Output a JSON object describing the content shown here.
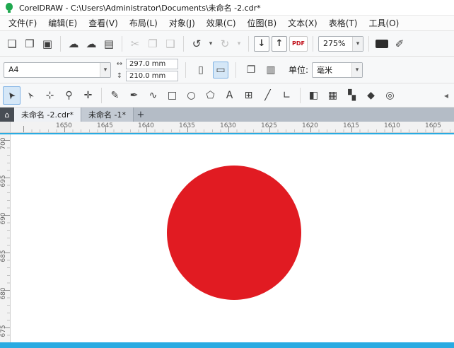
{
  "window": {
    "title": "CorelDRAW - C:\\Users\\Administrator\\Documents\\未命名 -2.cdr*"
  },
  "menu": {
    "items": [
      "文件(F)",
      "编辑(E)",
      "查看(V)",
      "布局(L)",
      "对象(J)",
      "效果(C)",
      "位图(B)",
      "文本(X)",
      "表格(T)",
      "工具(O)"
    ]
  },
  "toolbar": {
    "new_icon": "❏",
    "open_icon": "❒",
    "save_icon": "▣",
    "cloud_open_icon": "☁",
    "cloud_save_icon": "☁",
    "print_icon": "▤",
    "cut_icon": "✂",
    "copy_icon": "❐",
    "paste_icon": "❑",
    "undo_icon": "↺",
    "redo_icon": "↻",
    "caret": "▾",
    "import_icon": "↓",
    "export_icon": "↑",
    "pdf_label": "PDF",
    "zoom_value": "275%",
    "options_icon": "✐"
  },
  "property_bar": {
    "page_size": "A4",
    "caret": "▾",
    "width_icon": "↔",
    "width_value": "297.0 mm",
    "height_icon": "↕",
    "height_value": "210.0 mm",
    "portrait_icon": "▯",
    "landscape_icon": "▭",
    "all_pages_icon": "❐",
    "current_page_icon": "▥",
    "units_label": "单位:",
    "units_value": "毫米"
  },
  "toolbox": {
    "tools": [
      {
        "name": "pick",
        "glyph": "➤"
      },
      {
        "name": "shape",
        "glyph": "➢"
      },
      {
        "name": "crop",
        "glyph": "⊹"
      },
      {
        "name": "zoom",
        "glyph": "⚲"
      },
      {
        "name": "pan",
        "glyph": "✛"
      },
      {
        "name": "freehand",
        "glyph": "✎"
      },
      {
        "name": "pen",
        "glyph": "✒"
      },
      {
        "name": "b-spline",
        "glyph": "∿"
      },
      {
        "name": "rectangle",
        "glyph": "□"
      },
      {
        "name": "ellipse",
        "glyph": "○"
      },
      {
        "name": "polygon",
        "glyph": "⬠"
      },
      {
        "name": "text",
        "glyph": "A"
      },
      {
        "name": "table",
        "glyph": "⊞"
      },
      {
        "name": "dimension",
        "glyph": "╱"
      },
      {
        "name": "connector",
        "glyph": "∟"
      },
      {
        "name": "interactive-fill",
        "glyph": "◧"
      },
      {
        "name": "mesh-fill",
        "glyph": "▦"
      },
      {
        "name": "transparency",
        "glyph": "▚"
      },
      {
        "name": "eyedropper",
        "glyph": "◆"
      },
      {
        "name": "outline-pen",
        "glyph": "◎"
      }
    ],
    "scroll_left_icon": "◂"
  },
  "tabs": {
    "home_icon": "⌂",
    "items": [
      {
        "label": "未命名 -2.cdr*"
      },
      {
        "label": "未命名 -1*"
      }
    ],
    "add_label": "+"
  },
  "rulers": {
    "horizontal": [
      "1650",
      "1645",
      "1640",
      "1635",
      "1630",
      "1625",
      "1620",
      "1615",
      "1610",
      "1605"
    ],
    "vertical": [
      "700",
      "695",
      "690",
      "685",
      "680",
      "675"
    ]
  },
  "canvas": {
    "object": "red-circle",
    "circle_fill": "#e11b22",
    "circle_style": "background:#e11b22"
  },
  "colors": {
    "accent_cyan": "#29abe2",
    "logo_green": "#1fa84f",
    "corel_red": "#e11b22"
  }
}
